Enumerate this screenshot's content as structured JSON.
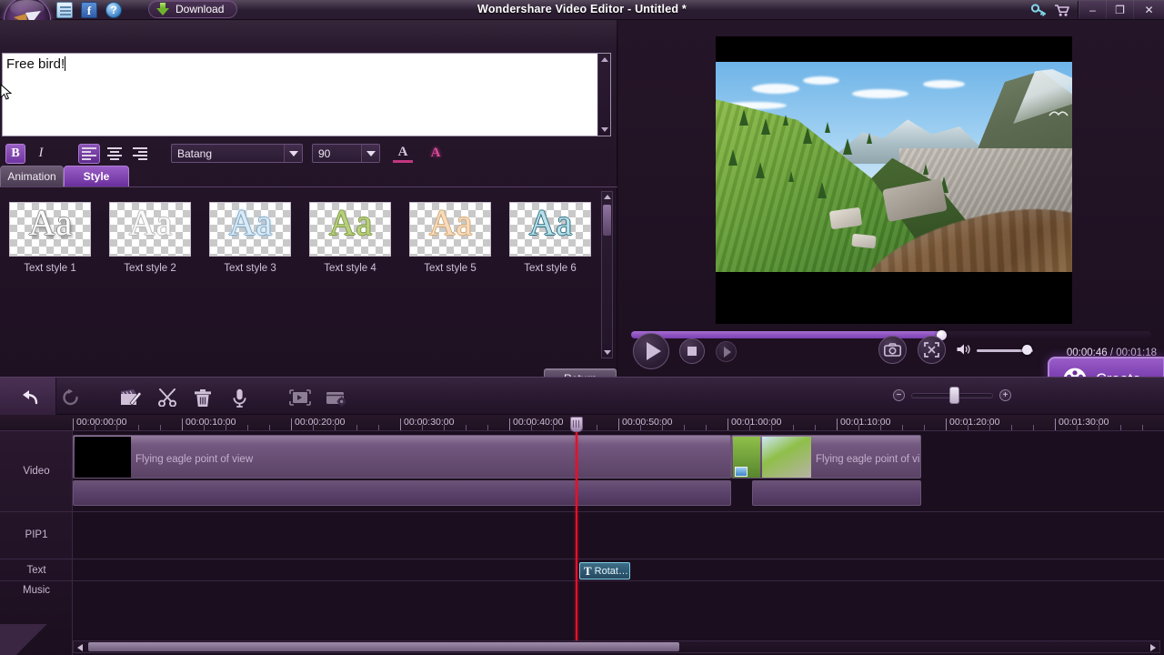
{
  "titlebar": {
    "app_title": "Wondershare Video Editor - Untitled *",
    "download_label": "Download",
    "icons": [
      "news-icon",
      "facebook-icon",
      "help-icon"
    ],
    "right_icons": [
      "key-icon",
      "cart-icon"
    ],
    "window_buttons": {
      "minimize": "–",
      "maximize": "❐",
      "close": "✕"
    }
  },
  "editor": {
    "text_value": "Free bird!",
    "format": {
      "bold_label": "B",
      "italic_label": "I",
      "align_left": "align-left-icon",
      "align_center": "align-center-icon",
      "align_right": "align-right-icon",
      "font_family": "Batang",
      "font_size": "90",
      "font_color_label": "A",
      "text_effect_label": "A"
    },
    "tabs": [
      {
        "label": "Animation",
        "active": false
      },
      {
        "label": "Style",
        "active": true
      }
    ],
    "styles": [
      {
        "label": "Text style 1",
        "fill": "#ffffff",
        "stroke": "#8e8e8e"
      },
      {
        "label": "Text style 2",
        "fill": "#fbfbfb",
        "stroke": "#b9b9b9"
      },
      {
        "label": "Text style 3",
        "fill": "#dceaf5",
        "stroke": "#7fa8c6"
      },
      {
        "label": "Text style 4",
        "fill": "#b8cf7e",
        "stroke": "#7e9a45"
      },
      {
        "label": "Text style 5",
        "fill": "#f6dcbe",
        "stroke": "#d2a774"
      },
      {
        "label": "Text style 6",
        "fill": "#b9e0ea",
        "stroke": "#2b6c80"
      }
    ],
    "return_label": "Return"
  },
  "preview": {
    "current_time": "00:00:46",
    "total_time": "00:01:18",
    "time_separator": " / ",
    "play_button": "play-icon",
    "stop_button": "stop-icon",
    "next_frame_button": "next-frame-icon",
    "snapshot_button": "camera-icon",
    "fullscreen_button": "fullscreen-icon",
    "volume_button": "volume-icon",
    "progress_percent": 59,
    "volume_percent": 81,
    "create_label": "Create"
  },
  "timeline": {
    "toolbar_icons": [
      "undo-icon",
      "redo-icon",
      "edit-icon",
      "split-icon",
      "delete-icon",
      "voiceover-icon",
      "freeze-frame-icon",
      "settings-icon"
    ],
    "zoom": {
      "minus": "−",
      "plus": "+",
      "level_percent": 50
    },
    "ruler_labels": [
      "00:00:00:00",
      "00:00:10:00",
      "00:00:20:00",
      "00:00:30:00",
      "00:00:40:00",
      "00:00:50:00",
      "00:01:00:00",
      "00:01:10:00",
      "00:01:20:00",
      "00:01:30:00"
    ],
    "tracks": [
      {
        "name": "Video"
      },
      {
        "name": "PIP1"
      },
      {
        "name": "Text"
      },
      {
        "name": "Music"
      }
    ],
    "clips": [
      {
        "track": "Video",
        "name": "Flying eagle point of view",
        "selected": false
      },
      {
        "track": "Video",
        "name": "Flying eagle point of vi…",
        "selected": false
      },
      {
        "track": "Text",
        "name": "Rotat…",
        "marker": "T",
        "selected": true
      }
    ],
    "playhead_time": "00:00:40:00"
  }
}
